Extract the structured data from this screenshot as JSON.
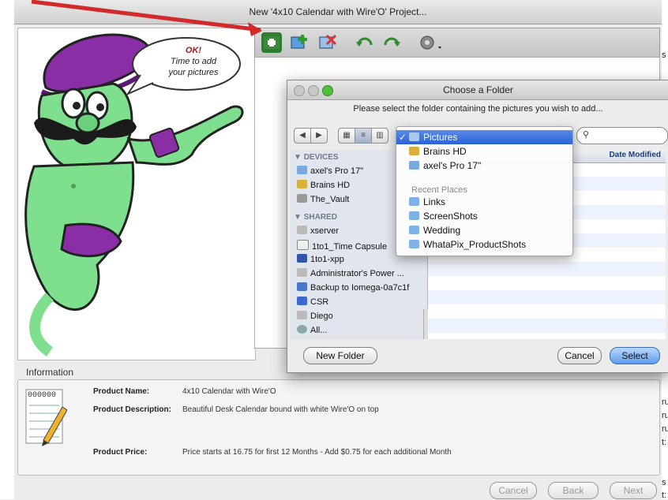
{
  "window": {
    "title": "New '4x10 Calendar with Wire'O' Project..."
  },
  "bubble": {
    "line1": "OK!",
    "line2": "Time to add",
    "line3": "your pictures"
  },
  "toolbar": {
    "icons": [
      "add-folder-icon",
      "add-picture-icon",
      "remove-picture-icon",
      "rotate-left-icon",
      "rotate-right-icon",
      "settings-gear-icon"
    ]
  },
  "dialog": {
    "title": "Choose a Folder",
    "prompt": "Please select the folder containing the pictures you wish to add...",
    "search_placeholder": "",
    "column_header": "Date Modified",
    "sidebar": {
      "devices_header": "DEVICES",
      "devices": [
        "axel's Pro 17\"",
        "Brains HD",
        "The_Vault"
      ],
      "shared_header": "SHARED",
      "shared": [
        "xserver",
        "1to1_Time Capsule",
        "1to1-xpp",
        "Administrator's Power ...",
        "Backup to Iomega-0a7c1f",
        "CSR",
        "Diego",
        "All..."
      ]
    },
    "popup": {
      "selected": "Pictures",
      "items": [
        "Brains HD",
        "axel's Pro 17\""
      ],
      "recent_header": "Recent Places",
      "recent": [
        "Links",
        "ScreenShots",
        "Wedding",
        "WhataPix_ProductShots"
      ]
    },
    "new_folder_label": "New Folder",
    "cancel_label": "Cancel",
    "select_label": "Select"
  },
  "info": {
    "label": "Information",
    "icon_digits": "000000",
    "product_name_label": "Product Name:",
    "product_name": "4x10 Calendar with Wire'O",
    "product_description_label": "Product Description:",
    "product_description": "Beautiful Desk Calendar bound with white Wire'O on top",
    "product_price_label": "Product Price:",
    "product_price": "Price starts at 16.75 for first 12 Months - Add $0.75 for each additional Month"
  },
  "footer": {
    "cancel": "Cancel",
    "back": "Back",
    "next": "Next"
  },
  "colors": {
    "accent": "#2a62d8",
    "arrow": "#d22a2a",
    "genie_skin": "#7ee08f",
    "turban": "#8a2ea6"
  },
  "edge_right": [
    "s",
    "ru",
    "ru",
    "ru",
    "t:",
    "s",
    "t:"
  ]
}
